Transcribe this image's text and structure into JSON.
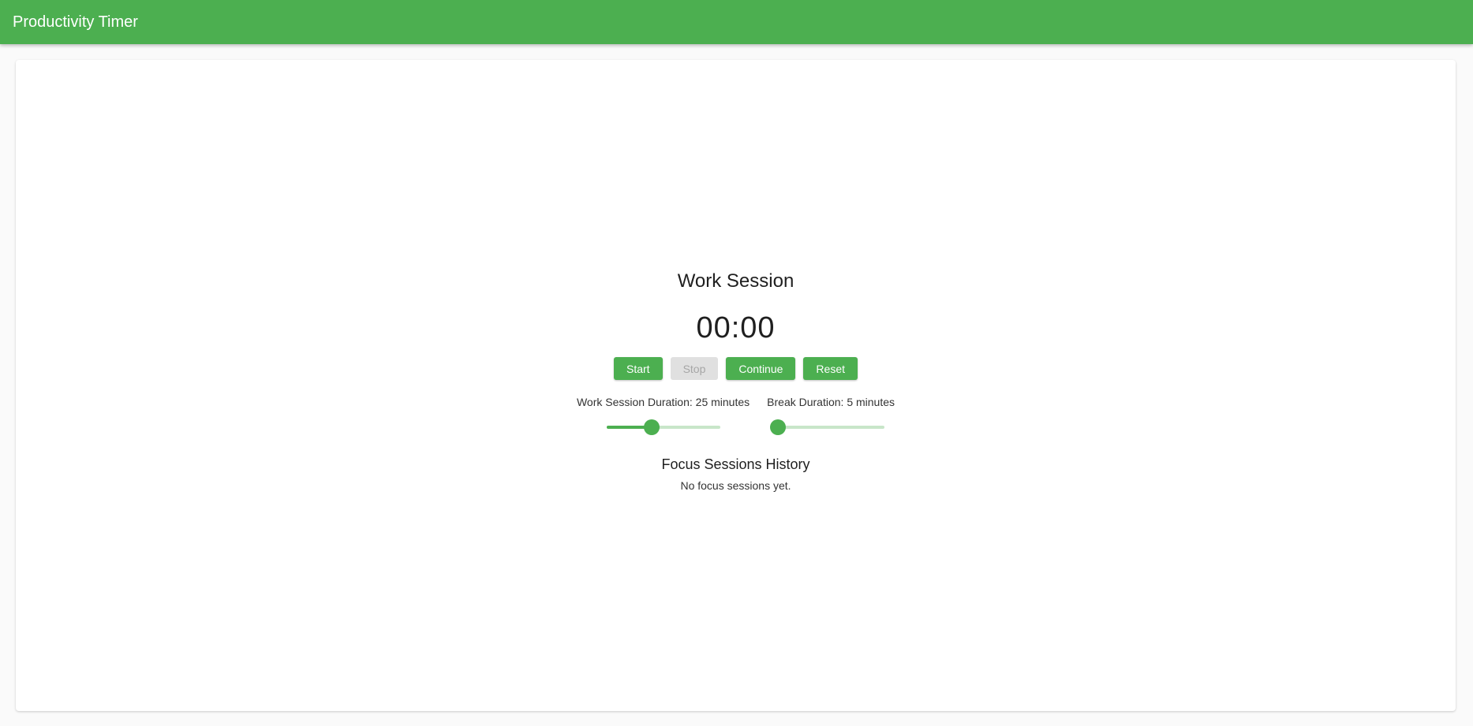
{
  "app": {
    "title": "Productivity Timer",
    "accent_color": "#4caf50"
  },
  "session": {
    "title": "Work Session",
    "time": "00:00"
  },
  "controls": {
    "start_label": "Start",
    "stop_label": "Stop",
    "continue_label": "Continue",
    "reset_label": "Reset",
    "stop_disabled": true
  },
  "settings": {
    "work_label": "Work Session Duration: 25 minutes",
    "work_value_fraction": 0.4,
    "break_label": "Break Duration: 5 minutes",
    "break_value_fraction": 0.0
  },
  "history": {
    "title": "Focus Sessions History",
    "empty_text": "No focus sessions yet."
  }
}
